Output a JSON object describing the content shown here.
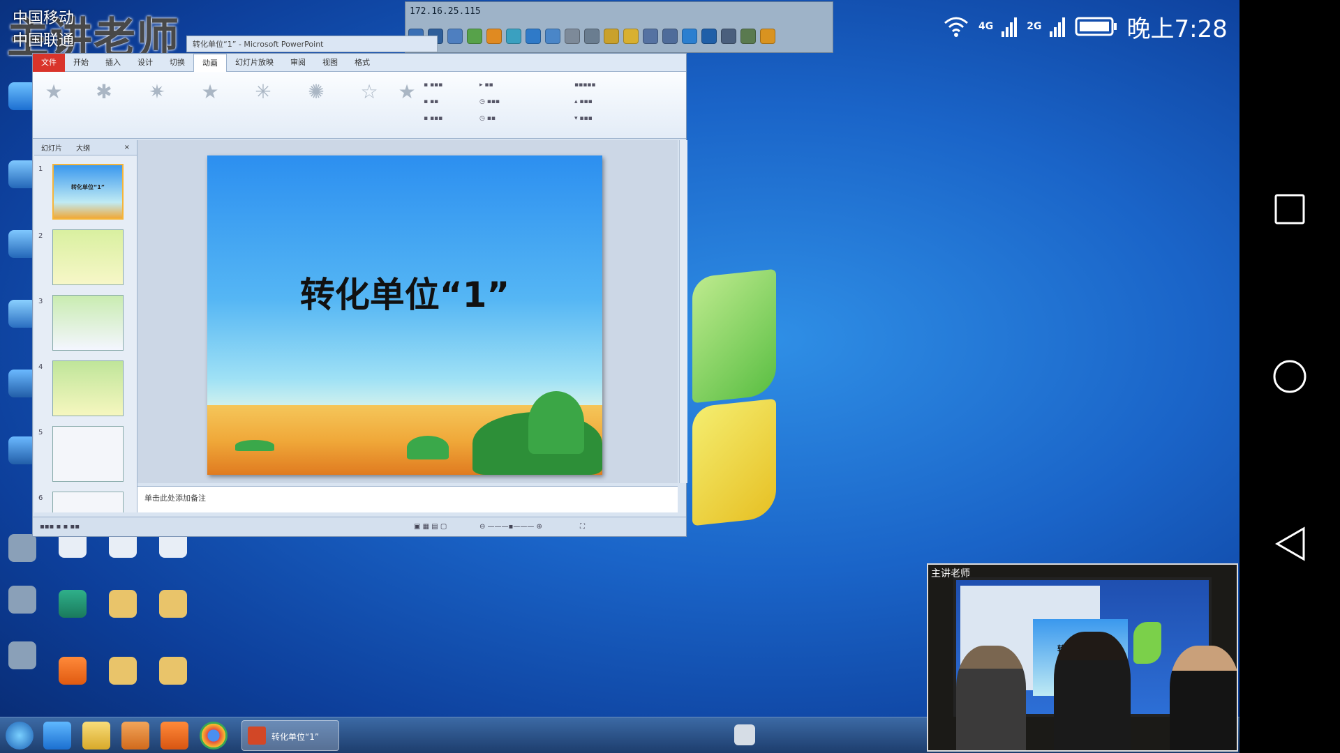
{
  "phone_status": {
    "time": "晚上7:28",
    "network_1": "4G",
    "network_2": "2G",
    "carrier_1": "中国移动",
    "carrier_2": "中国联通"
  },
  "watermark": "主讲老师",
  "remote_toolbar": {
    "address": "172.16.25.115"
  },
  "powerpoint": {
    "window_title": "转化单位“1” - Microsoft PowerPoint",
    "tabs": [
      "文件",
      "开始",
      "插入",
      "设计",
      "切换",
      "动画",
      "幻灯片放映",
      "审阅",
      "视图",
      "格式"
    ],
    "active_tab": "动画",
    "thumb_tabs": [
      "幻灯片",
      "大纲"
    ],
    "notes": "单击此处添加备注",
    "slides": [
      {
        "number": "1",
        "text": "转化单位“1”"
      },
      {
        "number": "2",
        "text": ""
      },
      {
        "number": "3",
        "text": ""
      },
      {
        "number": "4",
        "text": ""
      },
      {
        "number": "5",
        "text": ""
      },
      {
        "number": "6",
        "text": ""
      }
    ],
    "current_slide_title": "转化单位“1”"
  },
  "camera": {
    "label": "主讲老师",
    "slide_title": "转化单位“1”"
  },
  "colors": {
    "desktop": "#1a64c8",
    "ppt_file_tab": "#d9342b",
    "slide_sky": "#2c8ff0",
    "slide_ground": "#f0a93a"
  }
}
